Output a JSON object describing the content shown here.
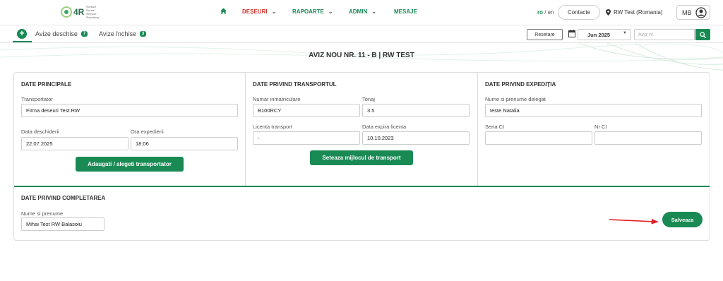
{
  "header": {
    "logo_text": "4R",
    "logo_sub": [
      "Reduce",
      "Reuse",
      "Recycle",
      "Reporting"
    ],
    "nav": [
      {
        "label": "DEȘEURI",
        "color": "#d0342c"
      },
      {
        "label": "RAPOARTE",
        "color": "#1a8a55"
      },
      {
        "label": "ADMIN",
        "color": "#1a8a55"
      },
      {
        "label": "MESAJE",
        "color": "#1a8a55"
      }
    ],
    "lang_active": "ro",
    "lang_sep": " / ",
    "lang_other": "en",
    "contact_label": "Contacte",
    "location": "RW Test (Romania)",
    "user_initials": "MB"
  },
  "subbar": {
    "tabs": [
      {
        "label": "Avize deschise",
        "count": "7"
      },
      {
        "label": "Avize închise",
        "count": "3"
      }
    ],
    "reset_label": "Resetare",
    "month_value": "Jun 2025",
    "search_placeholder": "Aviz nr."
  },
  "page_title": "AVIZ NOU NR. 11 - B | RW TEST",
  "sections": {
    "principale": {
      "title": "DATE PRINCIPALE",
      "transportator_label": "Transportator",
      "transportator_value": "Firma deseuri Test RW",
      "data_label": "Data deschiderii",
      "data_value": "22.07.2025",
      "ora_label": "Ora expedierii",
      "ora_value": "18:06",
      "button": "Adaugati / alegeti transportator"
    },
    "transport": {
      "title": "DATE PRIVIND TRANSPORTUL",
      "nr_label": "Numar inmatriculare",
      "nr_value": "B100RCY",
      "tonaj_label": "Tonaj",
      "tonaj_value": "3.5",
      "licenta_label": "Licenta transport",
      "licenta_value": "-",
      "expira_label": "Data expira licenta",
      "expira_value": "10.10.2023",
      "button": "Seteaza mijlocul de transport"
    },
    "expeditie": {
      "title": "DATE PRIVIND EXPEDIȚIA",
      "delegat_label": "Nume si prenume delegat",
      "delegat_value": "teste Natalia",
      "seria_label": "Seria CI",
      "seria_value": "",
      "nr_label": "Nr CI",
      "nr_value": ""
    },
    "completare": {
      "title": "DATE PRIVIND COMPLETAREA",
      "nume_label": "Nume si prenume",
      "nume_value": "Mihai Test RW Balasoiu",
      "save_label": "Salveaza"
    }
  },
  "colors": {
    "accent": "#1a8a55",
    "nav_active": "#d0342c",
    "arrow": "#e02020"
  }
}
